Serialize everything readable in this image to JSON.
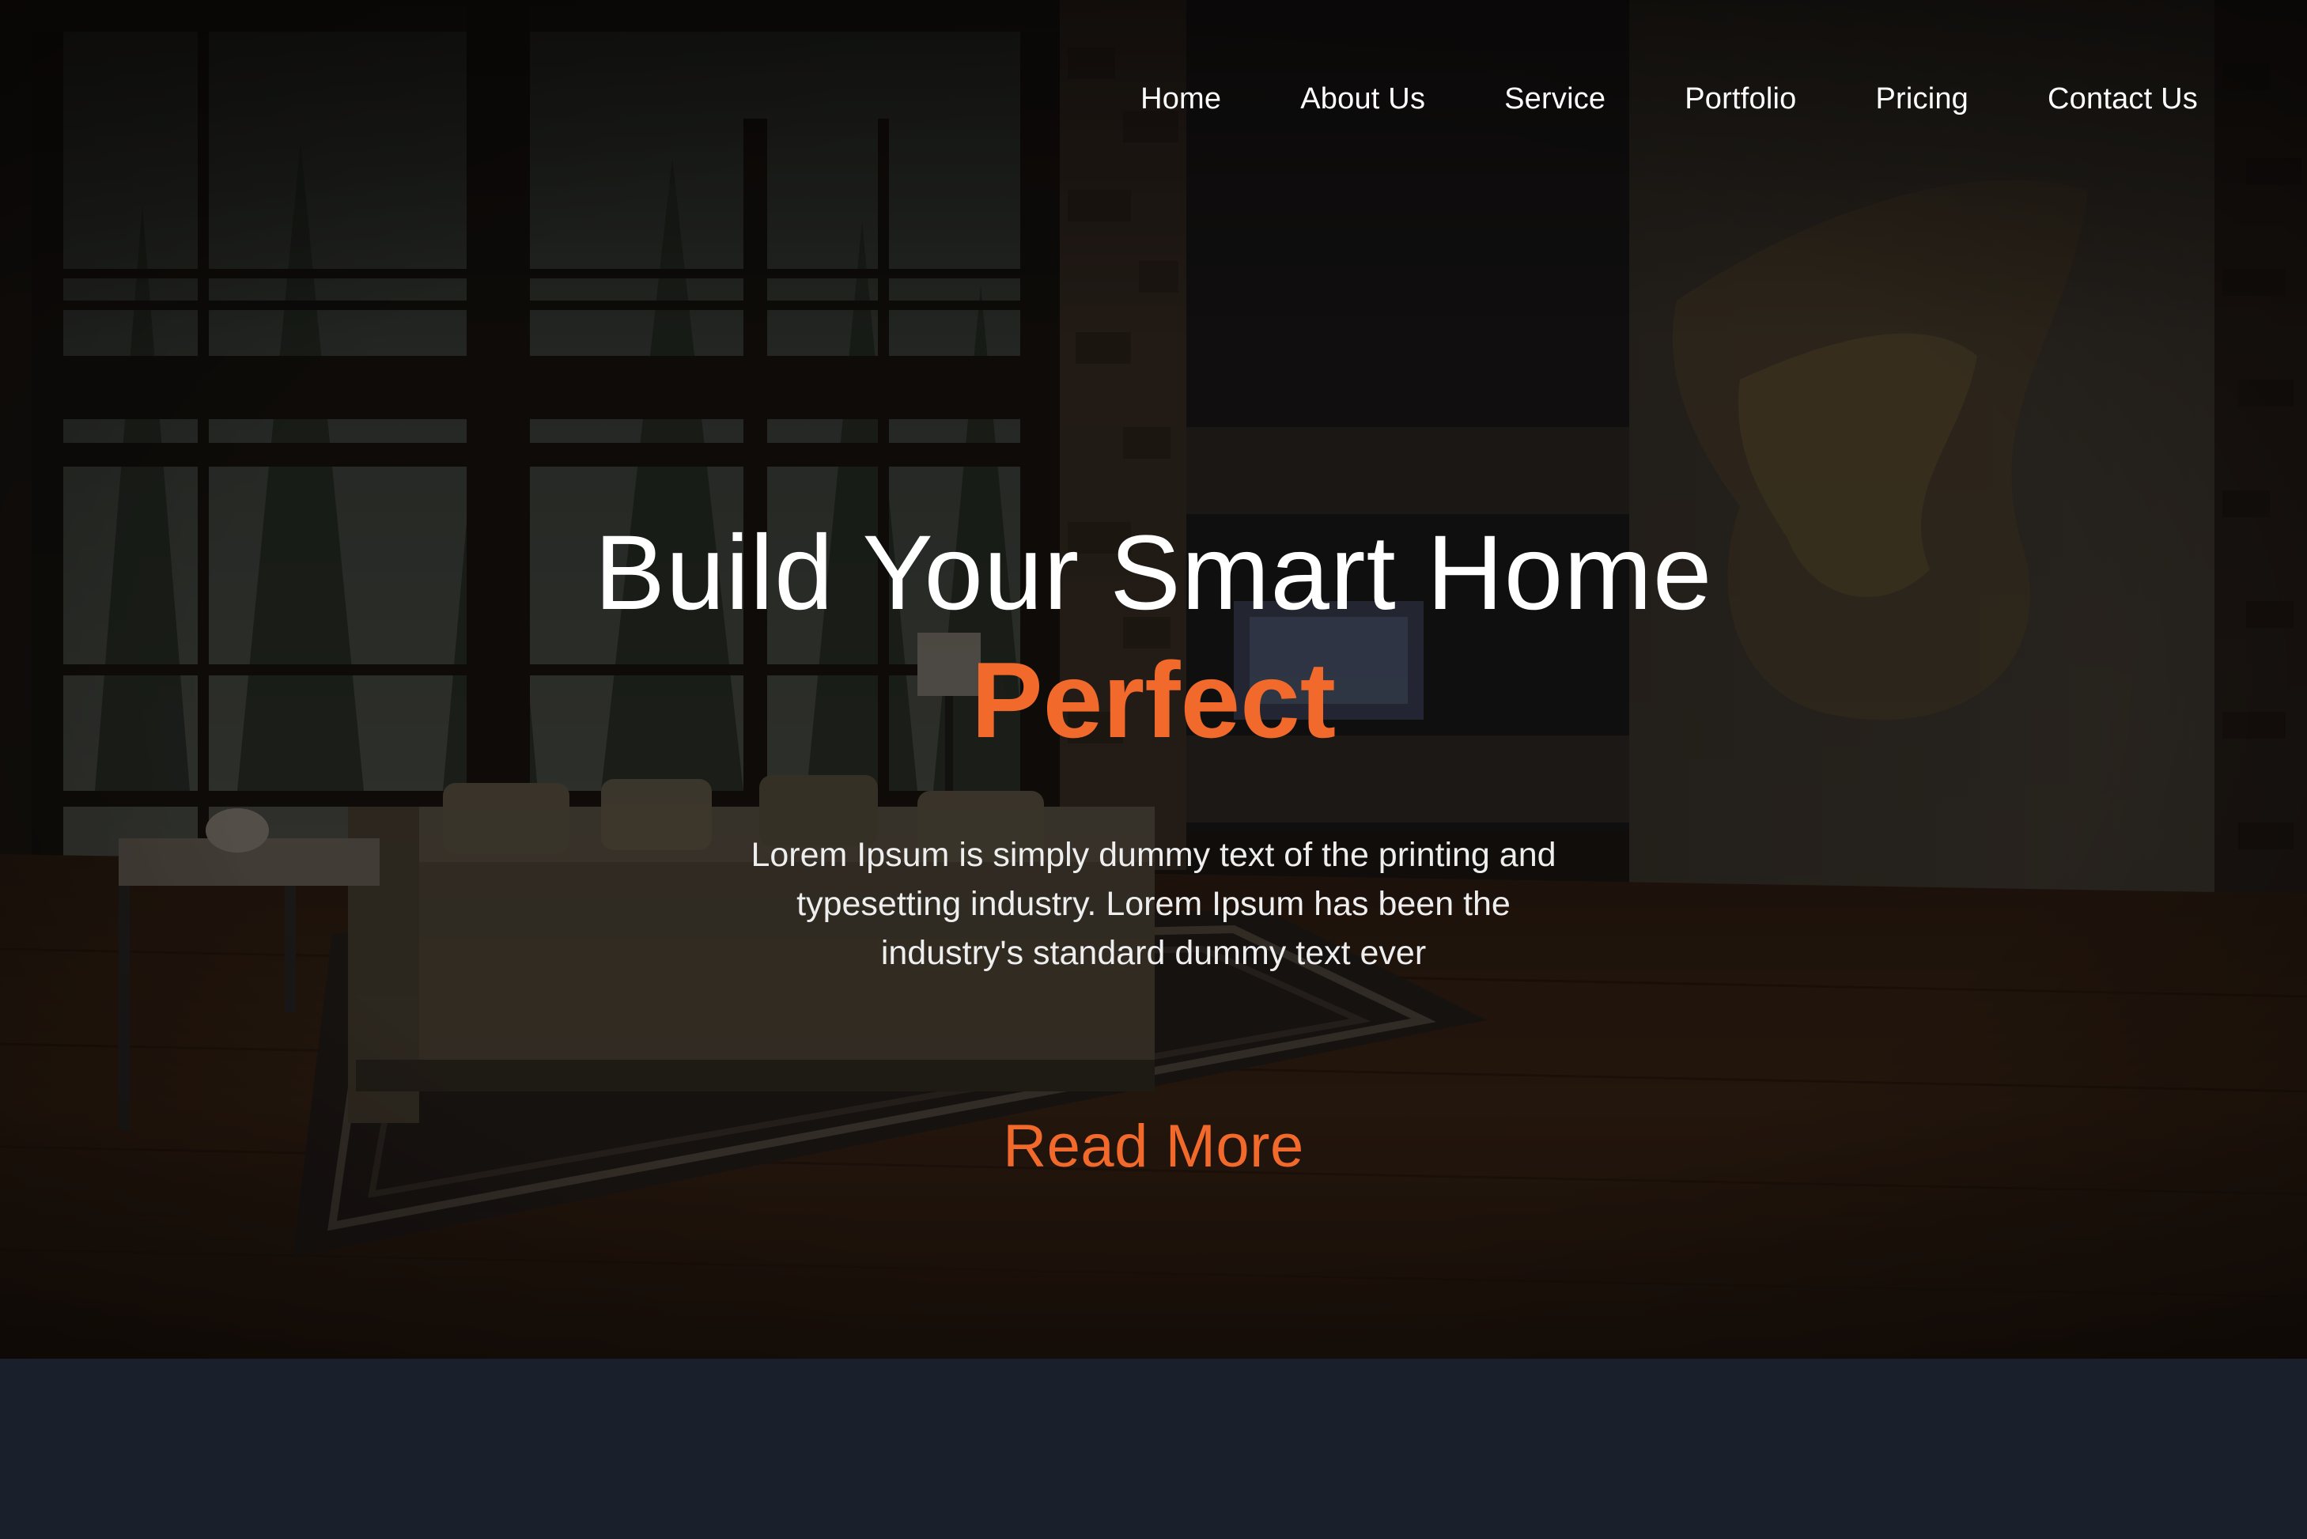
{
  "nav": {
    "items": [
      {
        "label": "Home"
      },
      {
        "label": "About Us"
      },
      {
        "label": "Service"
      },
      {
        "label": "Portfolio"
      },
      {
        "label": "Pricing"
      },
      {
        "label": "Contact Us"
      }
    ]
  },
  "hero": {
    "title": "Build Your Smart Home",
    "title_accent": "Perfect",
    "description": "Lorem Ipsum is simply dummy text of the printing and typesetting industry. Lorem Ipsum has been the industry's standard dummy text ever",
    "cta_label": "Read More",
    "background_image": "living-room-interior"
  },
  "colors": {
    "accent": "#f26a2b",
    "text": "#ffffff",
    "footer_bg": "#1a202b"
  }
}
